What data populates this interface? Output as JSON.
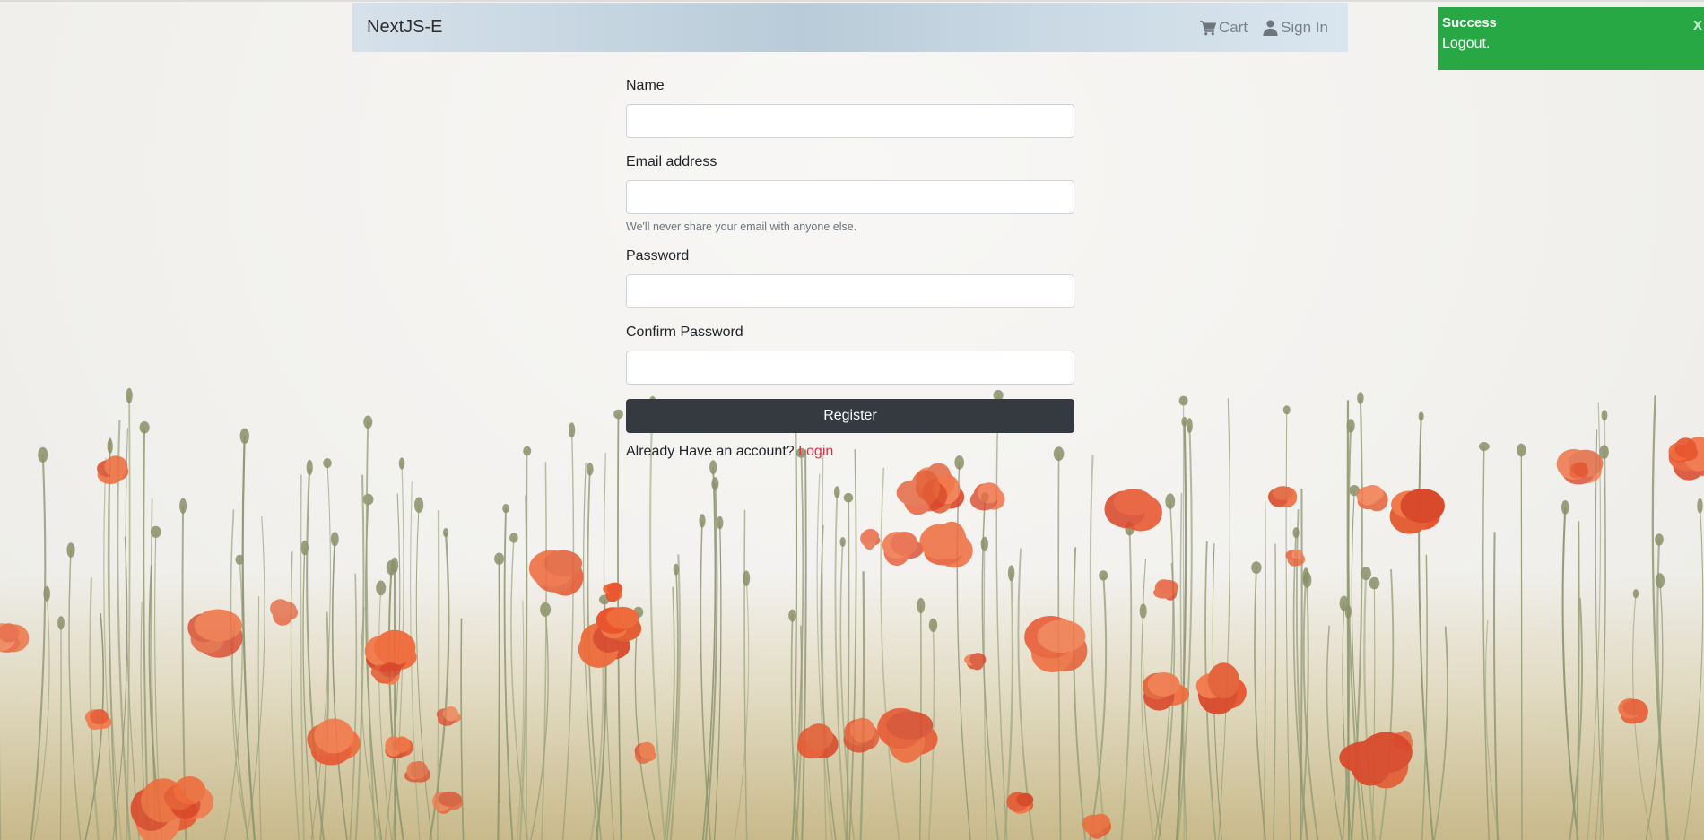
{
  "navbar": {
    "brand": "NextJS-E",
    "cart_label": "Cart",
    "signin_label": "Sign In",
    "cart_icon": "cart-icon",
    "signin_icon": "user-icon"
  },
  "form": {
    "name_label": "Name",
    "name_value": "",
    "email_label": "Email address",
    "email_value": "",
    "email_help": "We'll never share your email with anyone else.",
    "password_label": "Password",
    "password_value": "",
    "confirm_label": "Confirm Password",
    "confirm_value": "",
    "register_label": "Register",
    "already_text": "Already Have an account?",
    "login_label": "Login"
  },
  "toast": {
    "title": "Success",
    "message": "Logout.",
    "close_label": "x"
  },
  "colors": {
    "toast_bg": "#28a745",
    "button_bg": "#343a40",
    "login_link": "#dc3545"
  }
}
